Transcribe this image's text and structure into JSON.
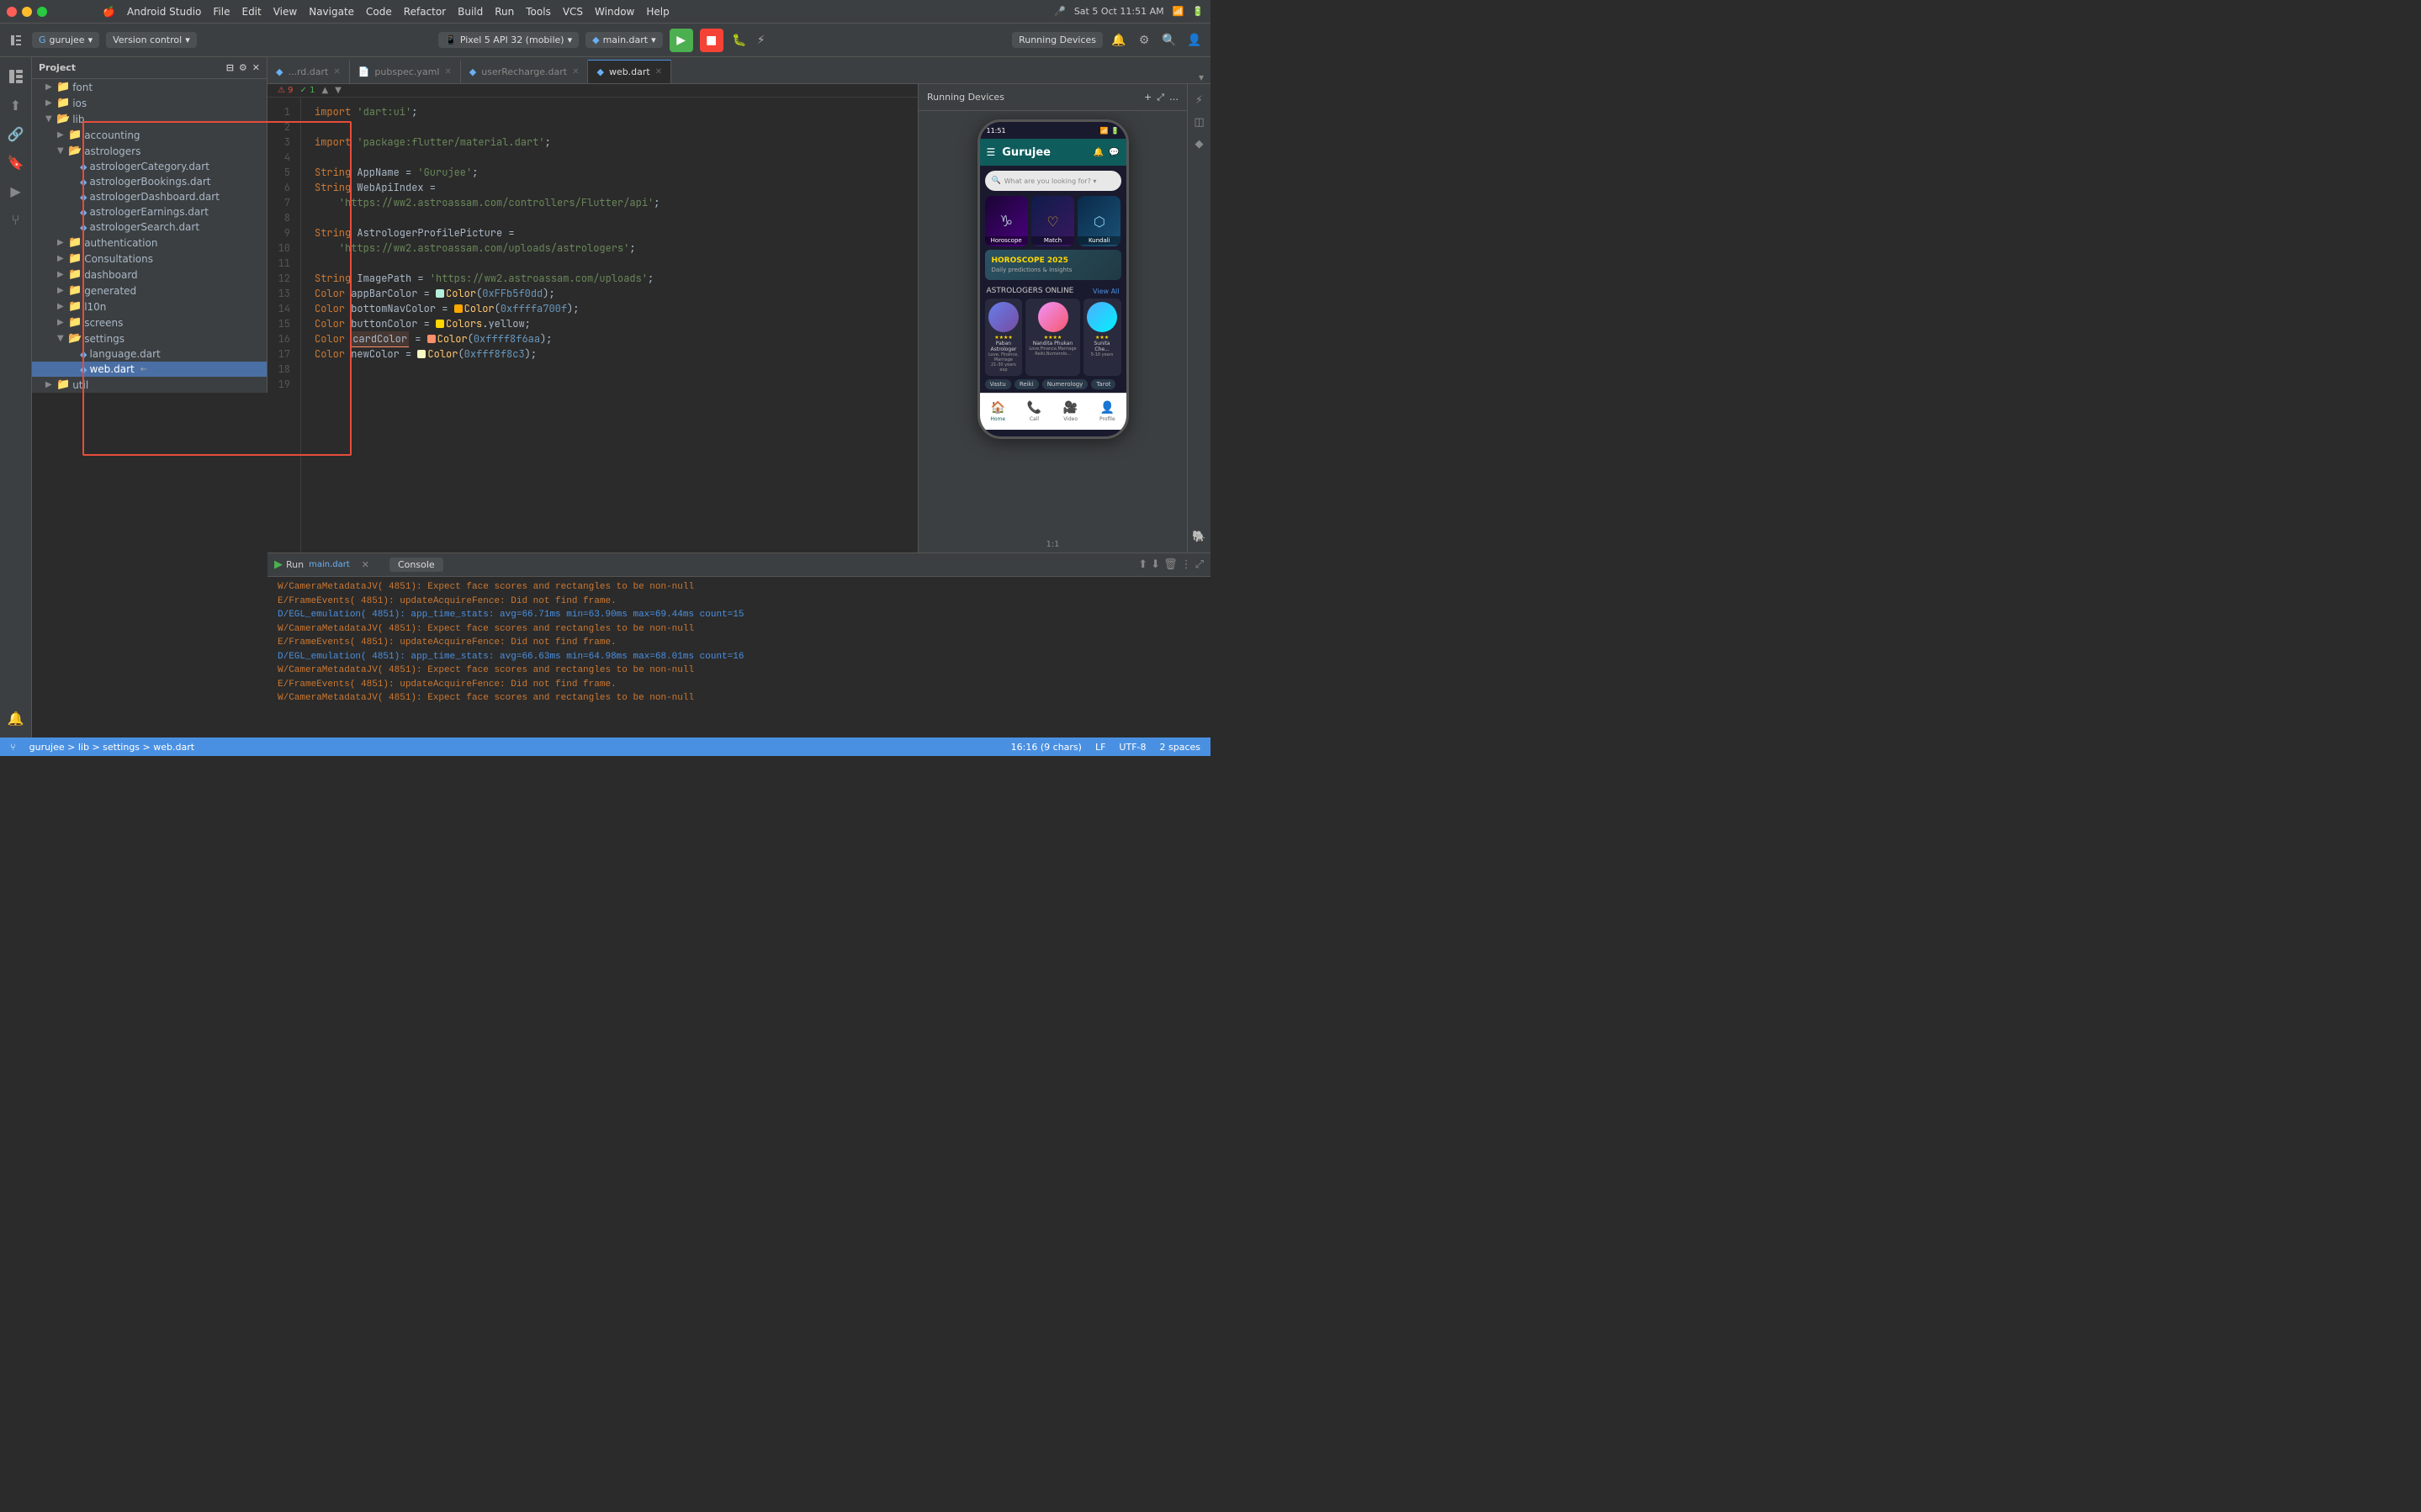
{
  "app": {
    "title": "Android Studio",
    "project_name": "gurujee",
    "version_control": "Version control"
  },
  "mac_menu": {
    "apple": "🍎",
    "items": [
      "Android Studio",
      "File",
      "Edit",
      "View",
      "Navigate",
      "Code",
      "Refactor",
      "Build",
      "Run",
      "Tools",
      "VCS",
      "Window",
      "Help"
    ]
  },
  "toolbar": {
    "project_label": "Project",
    "device_selector": "Pixel 5 API 32 (mobile)",
    "config_selector": "main.dart",
    "run_button_label": "▶",
    "stop_button_label": "■",
    "running_devices": "Running Devices"
  },
  "tabs": [
    {
      "label": "...rd.dart",
      "active": false,
      "closable": true
    },
    {
      "label": "pubspec.yaml",
      "active": false,
      "closable": true
    },
    {
      "label": "userRecharge.dart",
      "active": false,
      "closable": true
    },
    {
      "label": "web.dart",
      "active": true,
      "closable": true
    }
  ],
  "project_tree": {
    "root": "gurujee",
    "items": [
      {
        "indent": 1,
        "type": "folder",
        "open": false,
        "label": "font"
      },
      {
        "indent": 1,
        "type": "folder",
        "open": false,
        "label": "ios"
      },
      {
        "indent": 1,
        "type": "folder",
        "open": true,
        "label": "lib"
      },
      {
        "indent": 2,
        "type": "folder",
        "open": false,
        "label": "accounting"
      },
      {
        "indent": 2,
        "type": "folder",
        "open": true,
        "label": "astrologers"
      },
      {
        "indent": 3,
        "type": "file",
        "label": "astrologerCategory.dart"
      },
      {
        "indent": 3,
        "type": "file",
        "label": "astrologerBookings.dart"
      },
      {
        "indent": 3,
        "type": "file",
        "label": "astrologerDashboard.dart"
      },
      {
        "indent": 3,
        "type": "file",
        "label": "astrologerEarnings.dart"
      },
      {
        "indent": 3,
        "type": "file",
        "label": "astrologerSearch.dart"
      },
      {
        "indent": 2,
        "type": "folder",
        "open": false,
        "label": "authentication"
      },
      {
        "indent": 2,
        "type": "folder",
        "open": false,
        "label": "Consultations"
      },
      {
        "indent": 2,
        "type": "folder",
        "open": false,
        "label": "dashboard"
      },
      {
        "indent": 2,
        "type": "folder",
        "open": false,
        "label": "generated"
      },
      {
        "indent": 2,
        "type": "folder",
        "open": false,
        "label": "l10n"
      },
      {
        "indent": 2,
        "type": "folder",
        "open": false,
        "label": "screens"
      },
      {
        "indent": 2,
        "type": "folder",
        "open": true,
        "label": "settings"
      },
      {
        "indent": 3,
        "type": "file",
        "label": "language.dart"
      },
      {
        "indent": 3,
        "type": "file",
        "label": "web.dart",
        "active": true
      },
      {
        "indent": 1,
        "type": "folder",
        "open": false,
        "label": "util"
      }
    ]
  },
  "code": {
    "filename": "web.dart",
    "lines": [
      {
        "num": 1,
        "content": "import 'dart:ui';"
      },
      {
        "num": 2,
        "content": ""
      },
      {
        "num": 3,
        "content": "import 'package:flutter/material.dart';"
      },
      {
        "num": 4,
        "content": ""
      },
      {
        "num": 5,
        "content": "String AppName = 'Gurujee';"
      },
      {
        "num": 6,
        "content": "String WebApiIndex ="
      },
      {
        "num": 7,
        "content": "    'https://ww2.astroassam.com/controllers/Flutter/api';"
      },
      {
        "num": 8,
        "content": ""
      },
      {
        "num": 9,
        "content": "String AstrologerProfilePicture ="
      },
      {
        "num": 10,
        "content": "    'https://ww2.astroassam.com/uploads/astrologers';"
      },
      {
        "num": 11,
        "content": ""
      },
      {
        "num": 12,
        "content": "String ImagePath = 'https://ww2.astroassam.com/uploads';"
      },
      {
        "num": 13,
        "content": "Color appBarColor = Color(0xFFb5f0dd);"
      },
      {
        "num": 14,
        "content": "Color bottomNavColor = Color(0xffffa700f);"
      },
      {
        "num": 15,
        "content": "Color buttonColor = Colors.yellow;"
      },
      {
        "num": 16,
        "content": "Color cardColor = Color(0xffff8f6aa);"
      },
      {
        "num": 17,
        "content": "Color newColor = Color(0xfff8f8c3);"
      },
      {
        "num": 18,
        "content": ""
      },
      {
        "num": 19,
        "content": ""
      }
    ]
  },
  "color_dots": {
    "13": "#b5f0dd",
    "14": "#ffa700",
    "16": "#ff8f6a",
    "17": "#f8f8c3"
  },
  "phone_preview": {
    "title": "Running Devices",
    "status_time": "11:51",
    "app_name": "Gurujee",
    "search_placeholder": "What are you looking for? ▾",
    "grid_items": [
      {
        "label": "Horoscope"
      },
      {
        "label": "Match"
      },
      {
        "label": "Kundali"
      }
    ],
    "banner_text": "HOROSCOPE 2025",
    "astrologers_section": "ASTROLOGERS ONLINE",
    "view_all": "View All",
    "astrologers": [
      {
        "name": "Paban Astrologer",
        "spec": "Love, Finance, Marriage",
        "exp": "21-30 years exp",
        "stars": "★★★★"
      },
      {
        "name": "Nandita Phukan",
        "spec": "Love,Finance,Marriage",
        "exp": "Reiki,Numerolo...",
        "stars": "★★★★"
      },
      {
        "name": "Sunita Che...",
        "spec": "",
        "exp": "5-10 years",
        "stars": "★★★"
      }
    ],
    "service_tags": [
      "Vastu",
      "Reiki",
      "Numerology",
      "Tarot"
    ],
    "bottom_nav": [
      {
        "icon": "🏠",
        "label": "Home",
        "active": true
      },
      {
        "icon": "📞",
        "label": "Call",
        "active": false
      },
      {
        "icon": "🎥",
        "label": "Video",
        "active": false
      },
      {
        "icon": "👤",
        "label": "Profile",
        "active": false
      }
    ]
  },
  "console": {
    "tab_label": "Console",
    "run_tab": "Run",
    "lines": [
      "W/CameraMetadataJV( 4851): Expect face scores and rectangles to be non-null",
      "E/FrameEvents( 4851): updateAcquireFence: Did not find frame.",
      "D/EGL_emulation( 4851): app_time_stats: avg=66.71ms min=63.90ms max=69.44ms count=15",
      "W/CameraMetadataJV( 4851): Expect face scores and rectangles to be non-null",
      "E/FrameEvents( 4851): updateAcquireFence: Did not find frame.",
      "D/EGL_emulation( 4851): app_time_stats: avg=66.63ms min=64.98ms max=68.01ms count=16",
      "W/CameraMetadataJV( 4851): Expect face scores and rectangles to be non-null",
      "E/FrameEvents( 4851): updateAcquireFence: Did not find frame.",
      "W/CameraMetadataJV( 4851): Expect face scores and rectangles to be non-null"
    ]
  },
  "status_bar": {
    "breadcrumb": "gurujee > lib > settings > web.dart",
    "position": "16:16 (9 chars)",
    "encoding": "UTF-8",
    "line_sep": "LF",
    "indent": "2 spaces"
  },
  "run_tab": {
    "label": "Run",
    "config": "main.dart",
    "close": "✕"
  }
}
